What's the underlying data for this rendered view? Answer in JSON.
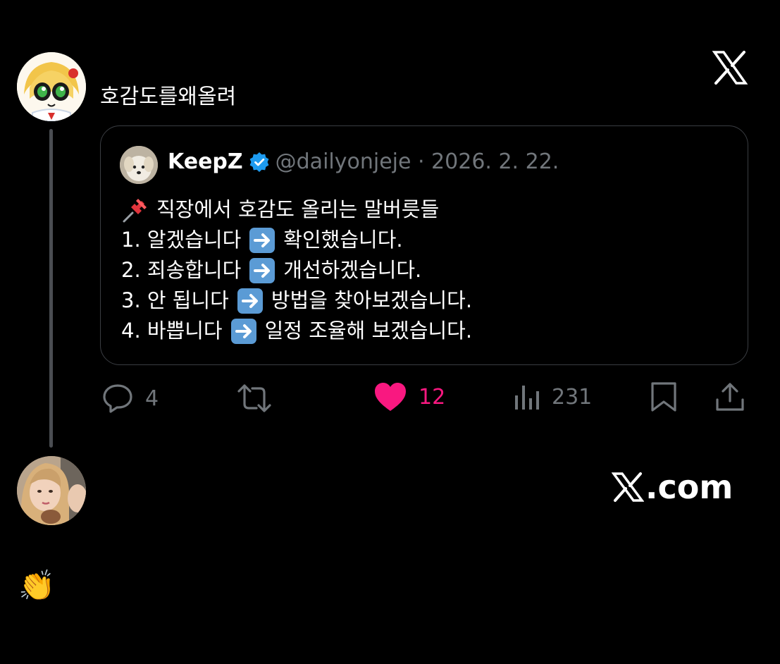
{
  "post": {
    "text": "호감도를왜올려"
  },
  "quote": {
    "author_name": "KeepZ",
    "handle_date": "@dailyonjeje · 2026. 2. 22.",
    "title_line": "직장에서 호감도 올리는 말버릇들",
    "items": [
      {
        "before": "1. 알겠습니다",
        "after": "확인했습니다."
      },
      {
        "before": "2. 죄송합니다",
        "after": "개선하겠습니다."
      },
      {
        "before": "3. 안 됩니다",
        "after": "방법을 찾아보겠습니다."
      },
      {
        "before": "4. 바쁩니다",
        "after": "일정 조율해 보겠습니다."
      }
    ]
  },
  "actions": {
    "replies": "4",
    "likes": "12",
    "views": "231"
  },
  "watermark": {
    "text": ".com"
  },
  "reply": {
    "emoji": "👏"
  },
  "colors": {
    "background": "#000000",
    "muted": "#71767b",
    "like": "#f91880",
    "verified": "#1d9bf0",
    "arrow_box": "#5b9bd5"
  }
}
